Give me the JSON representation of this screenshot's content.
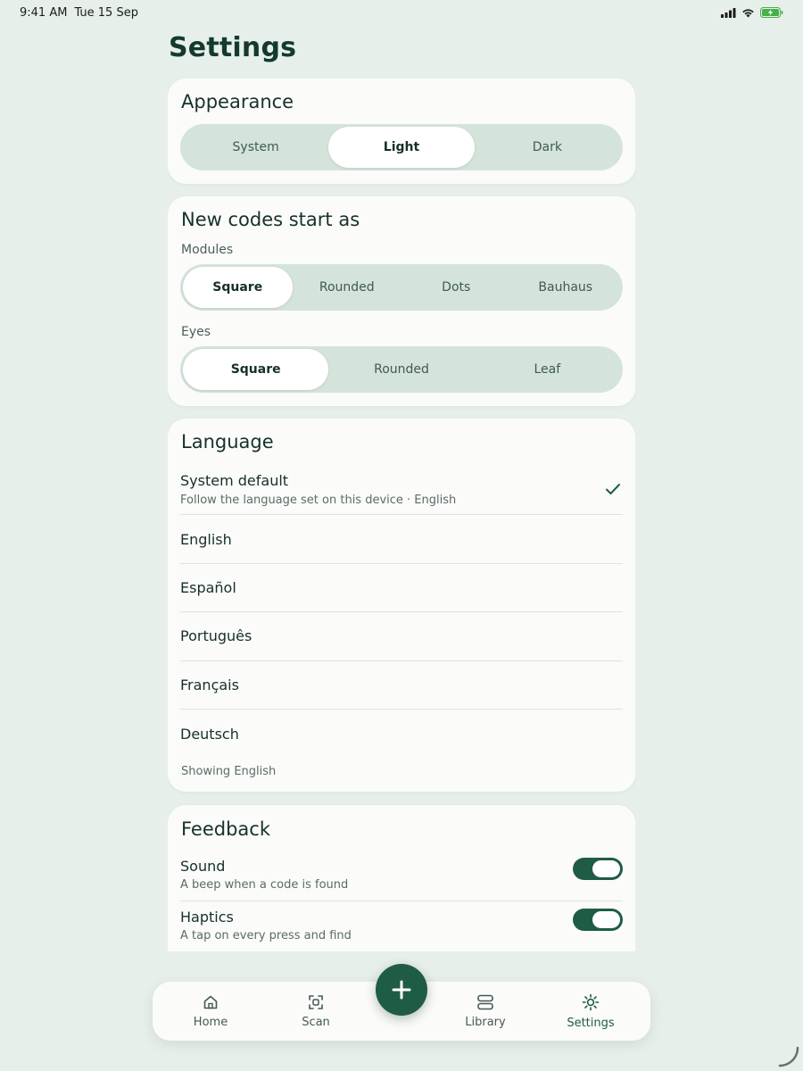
{
  "status": {
    "time": "9:41 AM",
    "date": "Tue 15 Sep"
  },
  "page": {
    "title": "Settings"
  },
  "appearance": {
    "title": "Appearance",
    "options": [
      "System",
      "Light",
      "Dark"
    ],
    "selected": "Light"
  },
  "new_codes": {
    "title": "New codes start as",
    "modules_label": "Modules",
    "modules_options": [
      "Square",
      "Rounded",
      "Dots",
      "Bauhaus"
    ],
    "modules_selected": "Square",
    "eyes_label": "Eyes",
    "eyes_options": [
      "Square",
      "Rounded",
      "Leaf"
    ],
    "eyes_selected": "Square"
  },
  "language": {
    "title": "Language",
    "items": [
      {
        "name": "System default",
        "desc": "Follow the language set on this device · English",
        "selected": true
      },
      {
        "name": "English"
      },
      {
        "name": "Español"
      },
      {
        "name": "Português"
      },
      {
        "name": "Français"
      },
      {
        "name": "Deutsch"
      }
    ],
    "footnote": "Showing English"
  },
  "feedback": {
    "title": "Feedback",
    "items": [
      {
        "name": "Sound",
        "desc": "A beep when a code is found",
        "enabled": true
      },
      {
        "name": "Haptics",
        "desc": "A tap on every press and find",
        "enabled": true
      }
    ]
  },
  "nav": {
    "tabs": [
      {
        "label": "Home",
        "icon": "home-icon"
      },
      {
        "label": "Scan",
        "icon": "scan-icon"
      },
      {
        "label": "Library",
        "icon": "library-icon"
      },
      {
        "label": "Settings",
        "icon": "settings-icon",
        "active": true
      }
    ],
    "fab_icon": "plus-icon"
  },
  "colors": {
    "accent": "#1f5c45",
    "background": "#e7efea",
    "segment_track": "#d4e4db"
  }
}
